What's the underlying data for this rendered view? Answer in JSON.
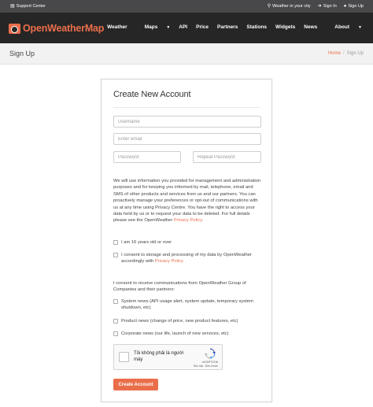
{
  "topbar": {
    "support": "Support Center",
    "weather_in_city": "Weather in your city",
    "sign_in": "Sign In",
    "sign_up": "Sign Up"
  },
  "brand": "OpenWeatherMap",
  "nav": {
    "weather": "Weather",
    "maps": "Maps",
    "api": "API",
    "price": "Price",
    "partners": "Partners",
    "stations": "Stations",
    "widgets": "Widgets",
    "news": "News",
    "about": "About"
  },
  "page": {
    "title": "Sign Up",
    "breadcrumb_home": "Home",
    "breadcrumb_sep": "/",
    "breadcrumb_current": "Sign Up"
  },
  "form": {
    "heading": "Create New Account",
    "username_placeholder": "Username",
    "email_placeholder": "Enter email",
    "password_placeholder": "Password",
    "repeat_password_placeholder": "Repeat Password",
    "info_text": "We will use information you provided for management and administration purposes and for keeping you informed by mail, telephone, email and SMS of other products and services from us and our partners. You can proactively manage your preferences or opt-out of communications with us at any time using Privacy Centre. You have the right to access your data held by us or to request your data to be deleted. For full details please see the OpenWeather ",
    "privacy_link": "Privacy Policy",
    "info_end": ".",
    "age_label": "I am 16 years old or over",
    "consent_label": "I consent to storage and processing of my data by OpenWeather accordingly with ",
    "consent_link": "Privacy Policy",
    "comms_intro": "I consent to receive communications from OpenWeather Group of Companies and their partners:",
    "system_news": "System news (API usage alert, system update, temporary system shutdown, etc)",
    "product_news": "Product news (change of price, new product features, etc)",
    "corporate_news": "Corporate news (our life, launch of new services, etc)",
    "captcha_text": "Tôi không phải là người máy",
    "captcha_brand": "reCAPTCHA",
    "captcha_terms": "Bảo mật - Điều khoản",
    "submit": "Create Account"
  },
  "colors": {
    "accent": "#eb6e4b",
    "navbar": "#262626",
    "topbar": "#48484a"
  }
}
